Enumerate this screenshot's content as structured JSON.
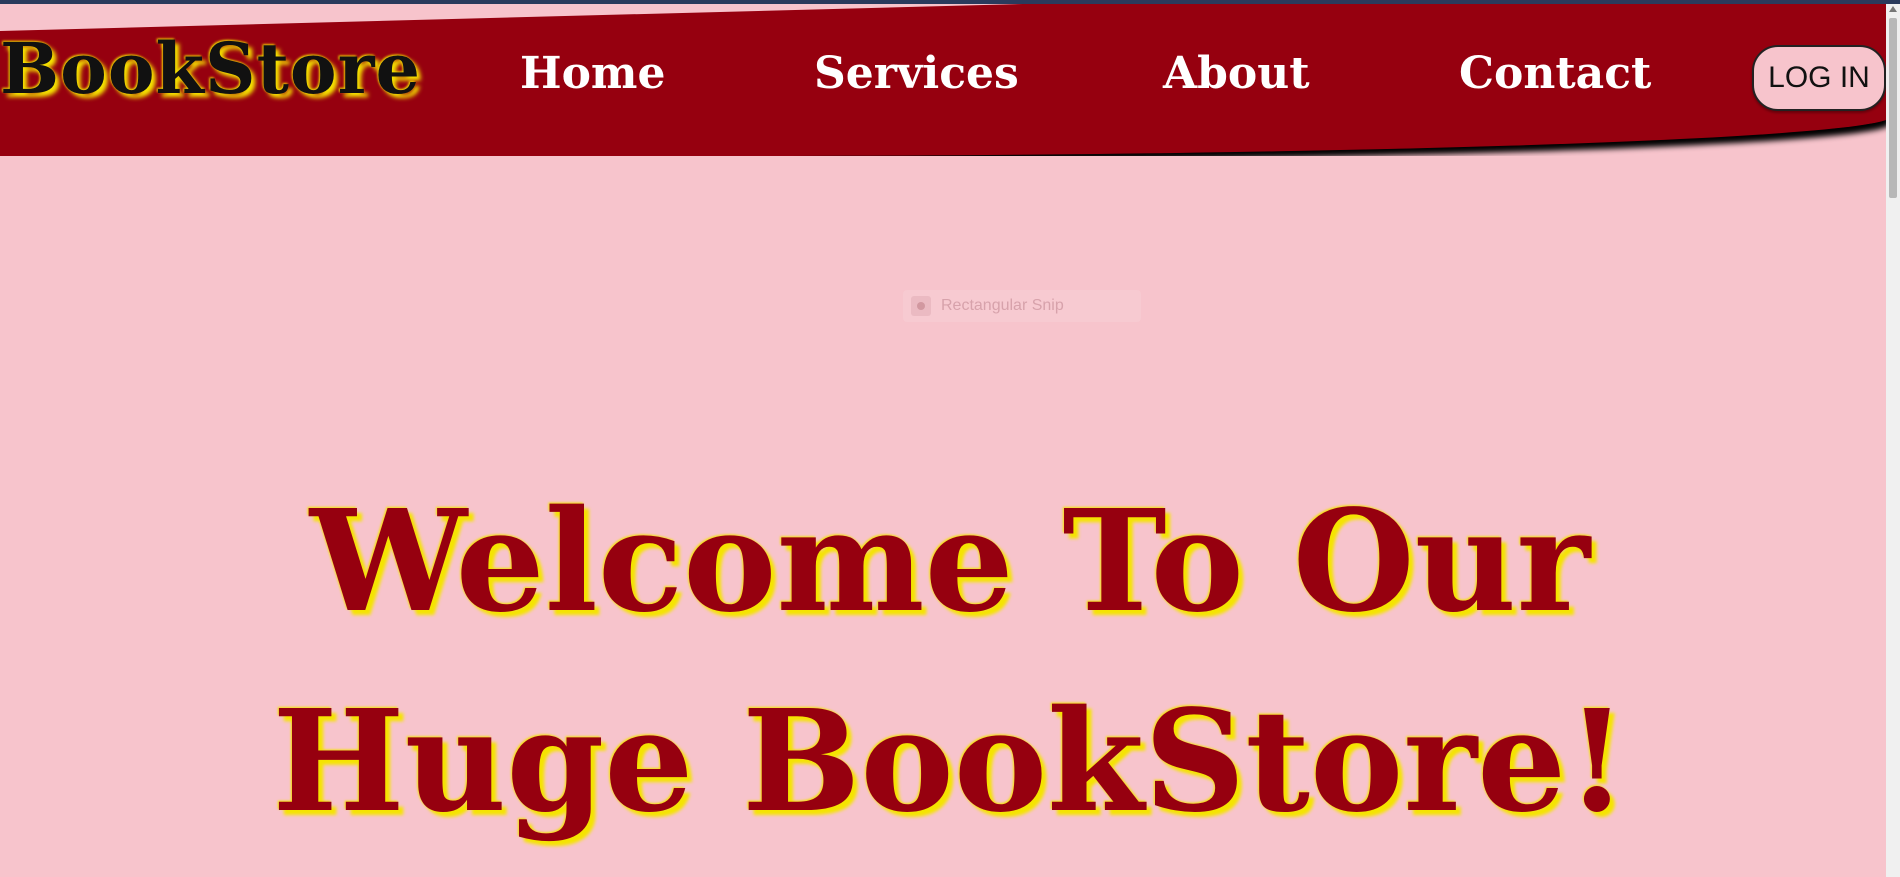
{
  "brand": {
    "logo_text": "BookStore"
  },
  "nav": {
    "items": [
      {
        "label": "Home"
      },
      {
        "label": "Services"
      },
      {
        "label": "About"
      },
      {
        "label": "Contact"
      }
    ],
    "login_label": "LOG IN"
  },
  "overlay": {
    "snip_label": "Rectangular Snip"
  },
  "hero": {
    "line1": "Welcome To Our",
    "line2": "Huge BookStore!"
  },
  "colors": {
    "background": "#f7c4cc",
    "nav_background": "#96000f",
    "heading_color": "#96000f",
    "glow": "#f5e400"
  }
}
